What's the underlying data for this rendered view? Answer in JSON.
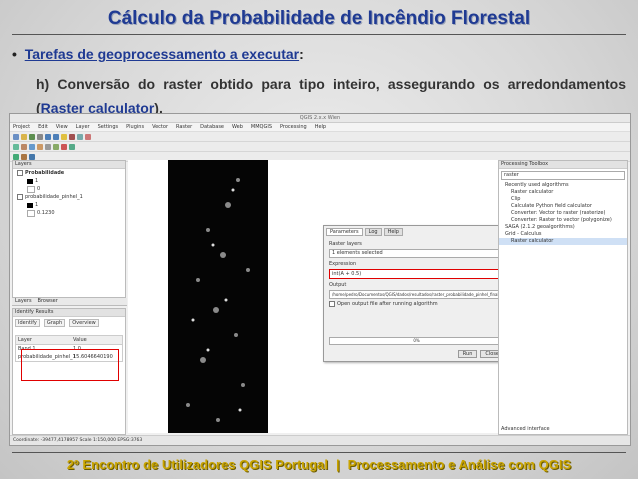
{
  "slide": {
    "title": "Cálculo da Probabilidade de Incêndio Florestal",
    "bullet_text": "Tarefas de geoprocessamento a executar",
    "bullet_colon": ":",
    "item_prefix": "h) Conversão do raster obtido para tipo inteiro, assegurando os arredondamentos (",
    "item_link": "Raster calculator",
    "item_suffix": ").",
    "footer_left": "2º Encontro de Utilizadores QGIS Portugal",
    "footer_sep": "|",
    "footer_right": "Processamento e Análise com QGIS"
  },
  "qgis": {
    "window_title": "QGIS 2.x.x Wien",
    "menus": [
      "Project",
      "Edit",
      "View",
      "Layer",
      "Settings",
      "Plugins",
      "Vector",
      "Raster",
      "Database",
      "Web",
      "MMQGIS",
      "Processing",
      "Help"
    ],
    "layers_title": "Layers",
    "layers": [
      {
        "name": "Probabilidade",
        "values": [
          "1",
          "0"
        ]
      },
      {
        "name": "probabilidade_pinhel_1",
        "values": [
          "1",
          "0.1230"
        ]
      }
    ],
    "panel_tabs": [
      "Layers",
      "Browser"
    ],
    "identify_title": "Identify Results",
    "identify_tabs": [
      "Identify",
      "Graph",
      "Overview"
    ],
    "identify_headers": [
      "Layer",
      "Value"
    ],
    "identify_rows": [
      {
        "layer": "Band 1",
        "value": "1.0"
      },
      {
        "layer": "probabilidade_pinhel_1",
        "value": "15.6046640190"
      }
    ],
    "dialog": {
      "tabs": [
        "Parameters",
        "Log",
        "Help"
      ],
      "layers_label": "Raster layers",
      "layers_value": "1 elements selected",
      "expr_label": "Expression",
      "expr_value": "int(A + 0.5)",
      "output_label": "Output",
      "output_value": "/home/pedro/Documentos/QGIS/dados/resultados/raster_probabilidade_pinhel_final.tif",
      "open_label": "Open output file after running algorithm",
      "progress": "0%",
      "run_label": "Run",
      "close_label": "Close"
    },
    "toolbox": {
      "title": "Processing Toolbox",
      "search": "raster",
      "items": [
        {
          "label": "Recently used algorithms",
          "level": 1
        },
        {
          "label": "Raster calculator",
          "level": 2
        },
        {
          "label": "Clip",
          "level": 2
        },
        {
          "label": "Calculate Python field calculator",
          "level": 2
        },
        {
          "label": "Converter: Vector to raster (rasterize)",
          "level": 2
        },
        {
          "label": "Converter: Raster to vector (polygonize)",
          "level": 2
        },
        {
          "label": "SAGA (2.1.2 geoalgorithms)",
          "level": 1
        },
        {
          "label": "Grid - Calculus",
          "level": 1
        },
        {
          "label": "Raster calculator",
          "level": 2,
          "selected": true
        }
      ],
      "advanced": "Advanced interface"
    },
    "status": "Coordinate: -39477,4178957  Scale 1:150,000  EPSG:3763"
  },
  "colors": {
    "title": "#1f3a93",
    "footer": "#c9a400",
    "highlight": "#e00000"
  }
}
